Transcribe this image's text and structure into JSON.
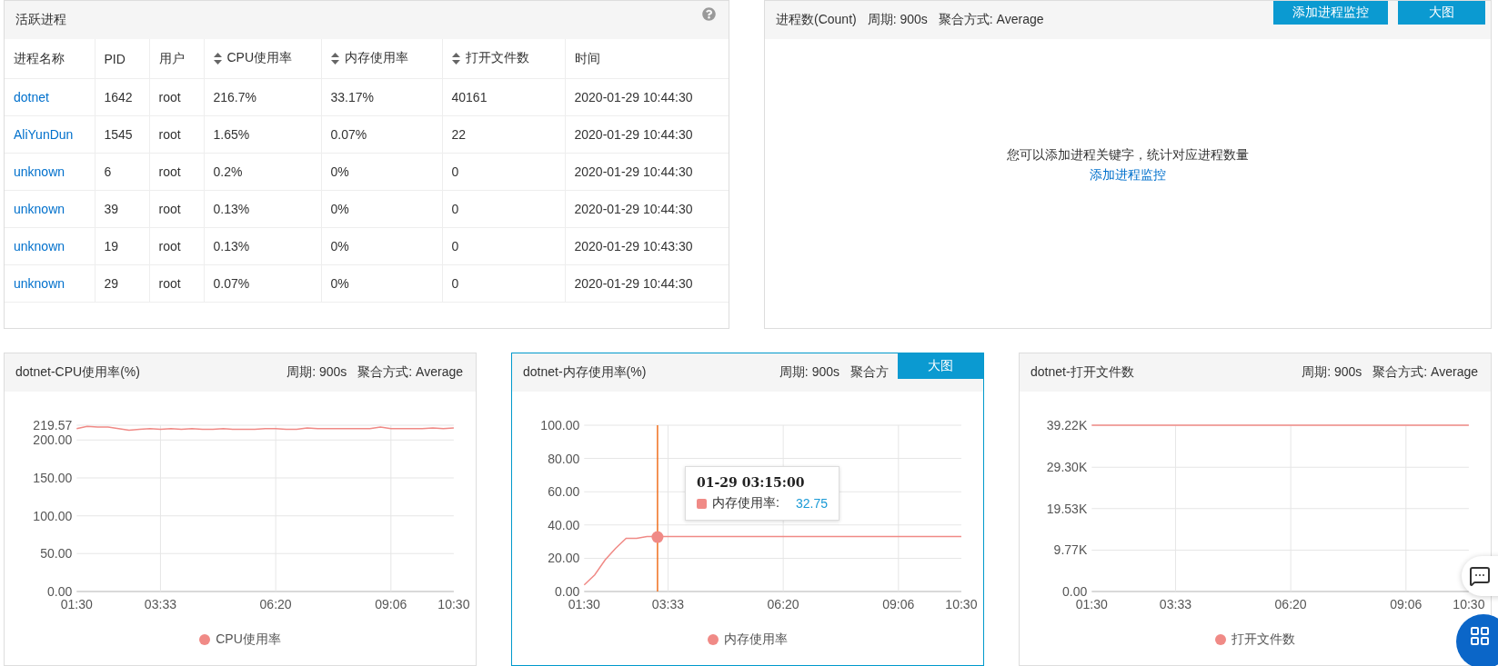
{
  "process_panel": {
    "title": "活跃进程",
    "columns": [
      {
        "label": "进程名称",
        "sortable": false,
        "kind": "link"
      },
      {
        "label": "PID",
        "sortable": false,
        "kind": "text"
      },
      {
        "label": "用户",
        "sortable": false,
        "kind": "text"
      },
      {
        "label": "CPU使用率",
        "sortable": true,
        "kind": "text"
      },
      {
        "label": "内存使用率",
        "sortable": true,
        "kind": "text"
      },
      {
        "label": "打开文件数",
        "sortable": true,
        "kind": "text"
      },
      {
        "label": "时间",
        "sortable": false,
        "kind": "text"
      }
    ],
    "rows": [
      [
        "dotnet",
        "1642",
        "root",
        "216.7%",
        "33.17%",
        "40161",
        "2020-01-29 10:44:30"
      ],
      [
        "AliYunDun",
        "1545",
        "root",
        "1.65%",
        "0.07%",
        "22",
        "2020-01-29 10:44:30"
      ],
      [
        "unknown",
        "6",
        "root",
        "0.2%",
        "0%",
        "0",
        "2020-01-29 10:44:30"
      ],
      [
        "unknown",
        "39",
        "root",
        "0.13%",
        "0%",
        "0",
        "2020-01-29 10:44:30"
      ],
      [
        "unknown",
        "19",
        "root",
        "0.13%",
        "0%",
        "0",
        "2020-01-29 10:43:30"
      ],
      [
        "unknown",
        "29",
        "root",
        "0.07%",
        "0%",
        "0",
        "2020-01-29 10:44:30"
      ]
    ]
  },
  "count_panel": {
    "title": "进程数(Count)",
    "period": "周期: 900s",
    "aggregation": "聚合方式: Average",
    "buttons": [
      "添加进程监控",
      "大图"
    ],
    "empty_message": "您可以添加进程关键字，统计对应进程数量",
    "empty_link": "添加进程监控"
  },
  "chart_panels": [
    {
      "title": "dotnet-CPU使用率(%)",
      "period": "周期: 900s",
      "aggregation": "聚合方式: Average",
      "chart_data": {
        "type": "line",
        "categories": [
          "01:30",
          null,
          null,
          null,
          null,
          null,
          null,
          null,
          "03:33",
          null,
          null,
          null,
          null,
          null,
          null,
          null,
          null,
          null,
          null,
          "06:20",
          null,
          null,
          null,
          null,
          null,
          null,
          null,
          null,
          null,
          null,
          "09:06",
          null,
          null,
          null,
          null,
          null,
          "10:30"
        ],
        "ylim": [
          0,
          219.57
        ],
        "grid": true,
        "yticks": [
          {
            "value": 0,
            "label": "0.00"
          },
          {
            "value": 50,
            "label": "50.00"
          },
          {
            "value": 100,
            "label": "100.00"
          },
          {
            "value": 150,
            "label": "150.00"
          },
          {
            "value": 200,
            "label": "200.00"
          },
          {
            "value": 219.57,
            "label": "219.57"
          }
        ],
        "series": [
          {
            "name": "CPU使用率",
            "color": "#f08a86",
            "values": [
              215,
              218,
              217,
              217,
              215,
              213,
              214,
              215,
              214,
              215,
              214,
              215,
              214,
              214,
              215,
              214,
              214,
              214,
              215,
              215,
              214,
              214,
              216,
              215,
              215,
              215,
              215,
              215,
              215,
              217,
              215,
              215,
              215,
              215,
              216,
              215,
              216
            ]
          }
        ]
      }
    },
    {
      "title": "dotnet-内存使用率(%)",
      "period": "周期: 900s",
      "aggregation": "聚合方",
      "button": "大图",
      "chart_data": {
        "type": "line",
        "categories": [
          "01:30",
          null,
          null,
          null,
          null,
          null,
          null,
          null,
          "03:33",
          null,
          null,
          null,
          null,
          null,
          null,
          null,
          null,
          null,
          null,
          "06:20",
          null,
          null,
          null,
          null,
          null,
          null,
          null,
          null,
          null,
          null,
          "09:06",
          null,
          null,
          null,
          null,
          null,
          "10:30"
        ],
        "ylim": [
          0,
          100
        ],
        "yticks": [
          {
            "value": 0,
            "label": "0.00"
          },
          {
            "value": 20,
            "label": "20.00"
          },
          {
            "value": 40,
            "label": "40.00"
          },
          {
            "value": 60,
            "label": "60.00"
          },
          {
            "value": 80,
            "label": "80.00"
          },
          {
            "value": 100,
            "label": "100.00"
          }
        ],
        "series": [
          {
            "name": "内存使用率",
            "color": "#f08a86",
            "values": [
              4,
              10,
              19,
              26,
              32,
              32,
              33,
              33,
              33,
              33,
              33,
              33,
              33,
              33,
              33,
              33,
              33,
              33,
              33,
              33,
              33,
              33,
              33,
              33,
              33,
              33,
              33,
              33,
              33,
              33,
              33,
              33,
              33,
              33,
              33,
              33,
              33
            ]
          }
        ],
        "grid": true,
        "annotations": [
          "32.75"
        ]
      },
      "tooltip": {
        "title": "01-29 03:15:00",
        "label": "内存使用率:"
      }
    },
    {
      "title": "dotnet-打开文件数",
      "period": "周期: 900s",
      "aggregation": "聚合方式: Average",
      "chart_data": {
        "type": "line",
        "categories": [
          "01:30",
          null,
          null,
          null,
          null,
          null,
          null,
          null,
          "03:33",
          null,
          null,
          null,
          null,
          null,
          null,
          null,
          null,
          null,
          null,
          "06:20",
          null,
          null,
          null,
          null,
          null,
          null,
          null,
          null,
          null,
          null,
          "09:06",
          null,
          null,
          null,
          null,
          null,
          "10:30"
        ],
        "ylim": [
          0,
          39220
        ],
        "grid": true,
        "yticks": [
          {
            "value": 0,
            "label": "0.00"
          },
          {
            "value": 9770,
            "label": "9.77K"
          },
          {
            "value": 19530,
            "label": "19.53K"
          },
          {
            "value": 29300,
            "label": "29.30K"
          },
          {
            "value": 39220,
            "label": "39.22K"
          }
        ],
        "series": [
          {
            "name": "打开文件数",
            "color": "#f08a86",
            "values": [
              39220,
              39220,
              39220,
              39220,
              39220,
              39220,
              39220,
              39220,
              39220,
              39220,
              39220,
              39220,
              39220,
              39220,
              39220,
              39220,
              39220,
              39220,
              39220,
              39220,
              39220,
              39220,
              39220,
              39220,
              39220,
              39220,
              39220,
              39220,
              39220,
              39220,
              39220,
              39220,
              39220,
              39220,
              39220,
              39220,
              39220
            ]
          }
        ]
      }
    }
  ]
}
